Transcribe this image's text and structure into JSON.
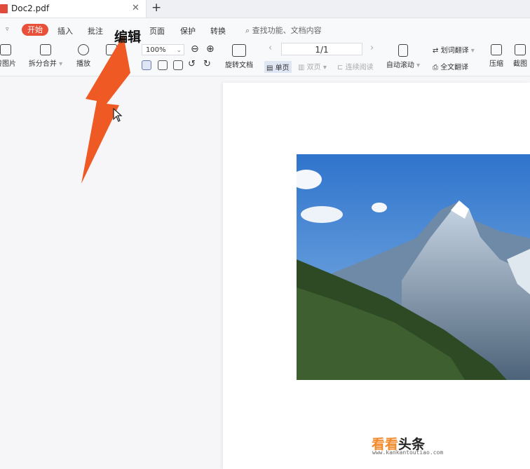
{
  "tab": {
    "title": "Doc2.pdf",
    "close": "✕",
    "new_tab": "+"
  },
  "menu": {
    "items": [
      "开始",
      "插入",
      "批注",
      "页面",
      "保护",
      "转换"
    ],
    "active_index": 0,
    "search_placeholder": "查找功能、文档内容",
    "overflow_caret": "▿"
  },
  "ribbon": {
    "to_image": "转图片",
    "split_merge": "拆分合并",
    "play": "播放",
    "zoom": "100%",
    "rotate_doc": "旋转文档",
    "page_indicator": "1/1",
    "single_page": "单页",
    "double_page": "双页",
    "continuous": "连续阅读",
    "auto_scroll": "自动滚动",
    "word_translate": "划词翻译",
    "full_translate": "全文翻译",
    "compress": "压缩",
    "screenshot": "截图"
  },
  "annotation": {
    "label": "编辑"
  },
  "watermark": {
    "brand_a": "看看",
    "brand_b": "头条",
    "url": "www.kankantoutiao.com"
  },
  "colors": {
    "accent": "#e8503a",
    "arrow": "#ef5a24",
    "sky": "#3a7fd0"
  }
}
